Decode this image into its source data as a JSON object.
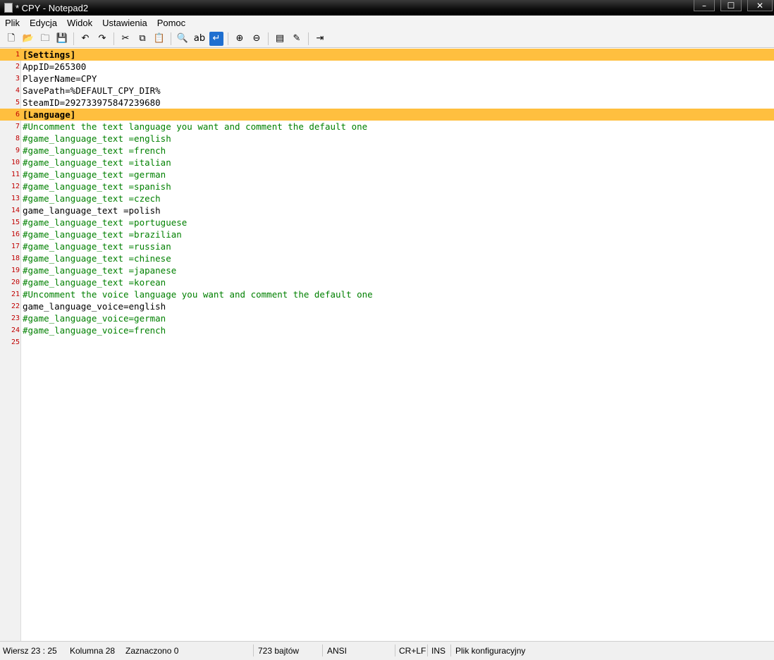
{
  "window": {
    "title": "* CPY - Notepad2",
    "minimize": "–",
    "maximize": "☐",
    "close": "✕"
  },
  "menu": [
    "Plik",
    "Edycja",
    "Widok",
    "Ustawienia",
    "Pomoc"
  ],
  "toolbar": {
    "icons": [
      "new-file-icon",
      "open-file-icon",
      "browse-icon",
      "save-icon",
      "undo-icon",
      "redo-icon",
      "cut-icon",
      "copy-icon",
      "paste-icon",
      "find-icon",
      "replace-icon",
      "word-wrap-icon",
      "zoom-in-icon",
      "zoom-out-icon",
      "select-scheme-icon",
      "customize-schemes-icon",
      "exit-icon"
    ],
    "glyphs": [
      "🗋",
      "📂",
      "🗀",
      "💾",
      "↶",
      "↷",
      "✂",
      "⧉",
      "📋",
      "🔍",
      "ab",
      "↵",
      "⊕",
      "⊖",
      "▤",
      "✎",
      "⇥"
    ]
  },
  "editor": {
    "lines": [
      {
        "n": "1",
        "text": "[Settings]",
        "kind": "section"
      },
      {
        "n": "2",
        "text": "AppID=265300",
        "kind": "kv"
      },
      {
        "n": "3",
        "text": "PlayerName=CPY",
        "kind": "kv"
      },
      {
        "n": "4",
        "text": "SavePath=%DEFAULT_CPY_DIR%",
        "kind": "kv"
      },
      {
        "n": "5",
        "text": "SteamID=292733975847239680",
        "kind": "kv"
      },
      {
        "n": "6",
        "text": "[Language]",
        "kind": "section"
      },
      {
        "n": "7",
        "text": "#Uncomment the text language you want and comment the default one",
        "kind": "comment"
      },
      {
        "n": "8",
        "text": "#game_language_text =english",
        "kind": "comment"
      },
      {
        "n": "9",
        "text": "#game_language_text =french",
        "kind": "comment"
      },
      {
        "n": "10",
        "text": "#game_language_text =italian",
        "kind": "comment"
      },
      {
        "n": "11",
        "text": "#game_language_text =german",
        "kind": "comment"
      },
      {
        "n": "12",
        "text": "#game_language_text =spanish",
        "kind": "comment"
      },
      {
        "n": "13",
        "text": "#game_language_text =czech",
        "kind": "comment"
      },
      {
        "n": "14",
        "text": "game_language_text =polish",
        "kind": "kv"
      },
      {
        "n": "15",
        "text": "#game_language_text =portuguese",
        "kind": "comment"
      },
      {
        "n": "16",
        "text": "#game_language_text =brazilian",
        "kind": "comment"
      },
      {
        "n": "17",
        "text": "#game_language_text =russian",
        "kind": "comment"
      },
      {
        "n": "18",
        "text": "#game_language_text =chinese",
        "kind": "comment"
      },
      {
        "n": "19",
        "text": "#game_language_text =japanese",
        "kind": "comment"
      },
      {
        "n": "20",
        "text": "#game_language_text =korean",
        "kind": "comment"
      },
      {
        "n": "21",
        "text": "#Uncomment the voice language you want and comment the default one",
        "kind": "comment"
      },
      {
        "n": "22",
        "text": "game_language_voice=english",
        "kind": "kv"
      },
      {
        "n": "23",
        "text": "#game_language_voice=german",
        "kind": "comment"
      },
      {
        "n": "24",
        "text": "#game_language_voice=french",
        "kind": "comment"
      },
      {
        "n": "25",
        "text": "",
        "kind": "kv"
      }
    ]
  },
  "status": {
    "line_col": "Wiersz 23 : 25",
    "column": "Kolumna 28",
    "selected": "Zaznaczono 0",
    "size": "723 bajtów",
    "encoding": "ANSI",
    "eol": "CR+LF",
    "ins": "INS",
    "scheme": "Plik konfiguracyjny"
  }
}
